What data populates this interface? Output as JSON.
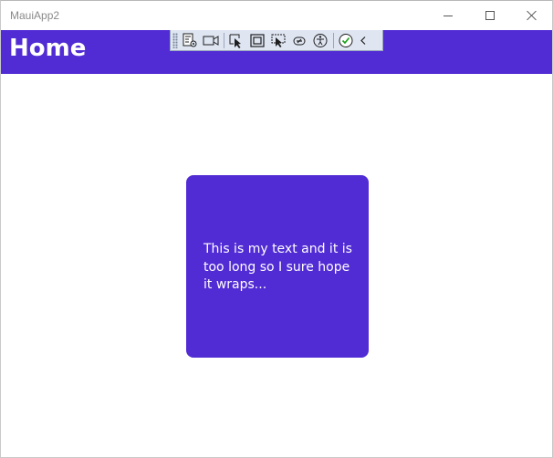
{
  "window": {
    "title": "MauiApp2"
  },
  "navbar": {
    "title": "Home",
    "color": "#512bd4"
  },
  "dev_toolbar": {
    "icons": [
      "grip-handle",
      "live-visual-tree-icon",
      "video-camera-icon",
      "select-element-icon",
      "display-layout-adorners-icon",
      "track-focused-element-icon",
      "binding-failures-icon",
      "accessibility-checker-icon",
      "checkmark-icon",
      "collapse-chevron-icon"
    ]
  },
  "card": {
    "text": "This is my text and it is too long so I sure hope it wraps...",
    "color": "#512bd4"
  }
}
